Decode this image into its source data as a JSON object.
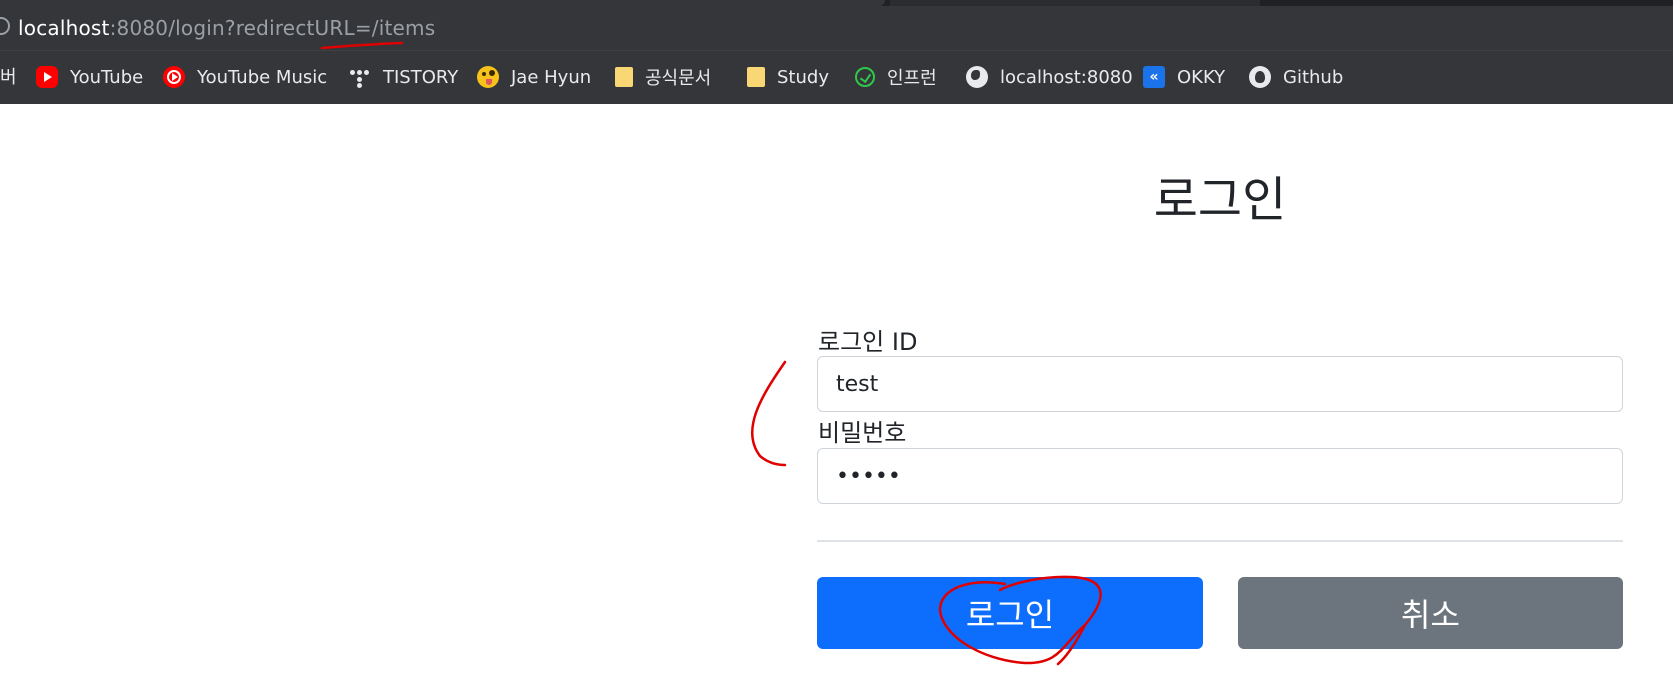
{
  "browser": {
    "url_host": "localhost",
    "url_rest": ":8080/login?redirectURL=/items"
  },
  "bookmarks": {
    "cut_label": "버",
    "items": [
      {
        "label": "YouTube",
        "icon": "youtube-icon"
      },
      {
        "label": "YouTube Music",
        "icon": "youtube-music-icon"
      },
      {
        "label": "TISTORY",
        "icon": "tistory-icon"
      },
      {
        "label": "Jae Hyun",
        "icon": "emoji-icon"
      },
      {
        "label": "공식문서",
        "icon": "folder-icon"
      },
      {
        "label": "Study",
        "icon": "folder-icon"
      },
      {
        "label": "인프런",
        "icon": "inflearn-icon"
      },
      {
        "label": "localhost:8080",
        "icon": "globe-icon"
      },
      {
        "label": "OKKY",
        "icon": "okky-icon"
      },
      {
        "label": "Github",
        "icon": "github-icon"
      }
    ]
  },
  "login": {
    "title": "로그인",
    "id_label": "로그인 ID",
    "id_value": "test",
    "password_label": "비밀번호",
    "password_value": "•••••",
    "submit_label": "로그인",
    "cancel_label": "취소"
  },
  "colors": {
    "primary": "#0d6efd",
    "secondary": "#6c757d",
    "annotation": "#e00000"
  }
}
